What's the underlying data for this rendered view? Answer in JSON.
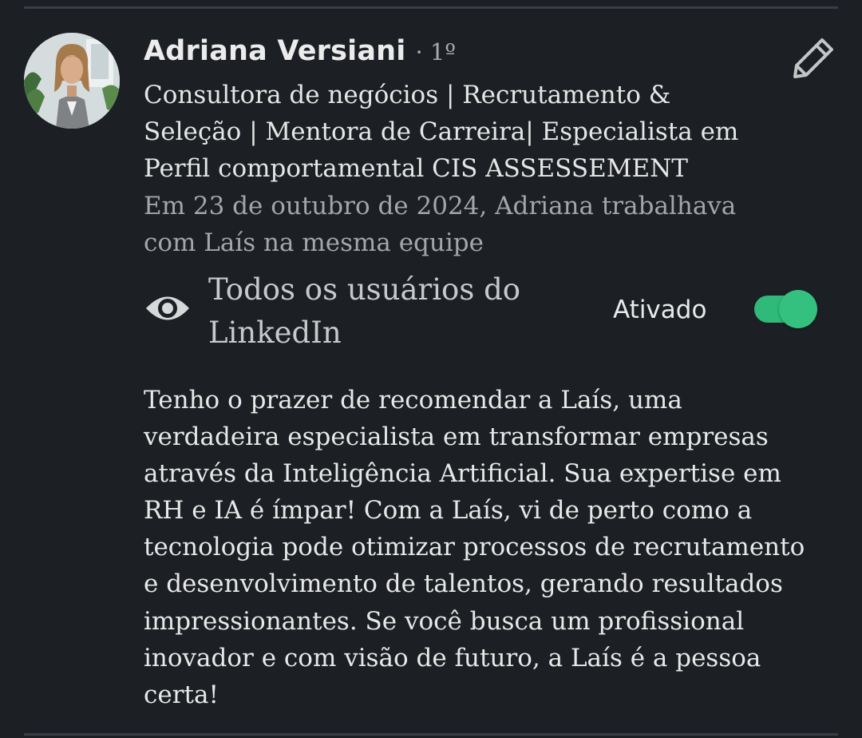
{
  "author": {
    "name": "Adriana Versiani",
    "degree": "· 1º",
    "headline_lines": [
      "Consultora de negócios | Recrutamento &",
      "Seleção | Mentora de Carreira| Especialista em",
      "Perfil comportamental CIS ASSESSEMENT"
    ],
    "relation_lines": [
      "Em 23 de outubro de 2024, Adriana trabalhava",
      "com Laís na mesma equipe"
    ]
  },
  "visibility": {
    "icon": "eye-icon",
    "lines": [
      "Todos os usuários do",
      "LinkedIn"
    ],
    "status": "Ativado",
    "toggle_on": true
  },
  "recommendation": {
    "lines": [
      "Tenho o prazer de recomendar a Laís, uma",
      "verdadeira especialista em transformar empresas",
      "através da Inteligência Artificial. Sua expertise em",
      "RH e IA é ímpar! Com a Laís, vi de perto como a",
      "tecnologia pode otimizar processos de recrutamento",
      "e desenvolvimento de talentos, gerando resultados",
      "impressionantes. Se você busca um profissional",
      "inovador e com visão de futuro, a Laís é a pessoa",
      "certa!"
    ]
  },
  "actions": {
    "edit_icon": "pencil-icon"
  },
  "colors": {
    "background": "#1c1f23",
    "toggle_accent": "#2fba7a",
    "secondary_text": "#a4a6a9"
  }
}
